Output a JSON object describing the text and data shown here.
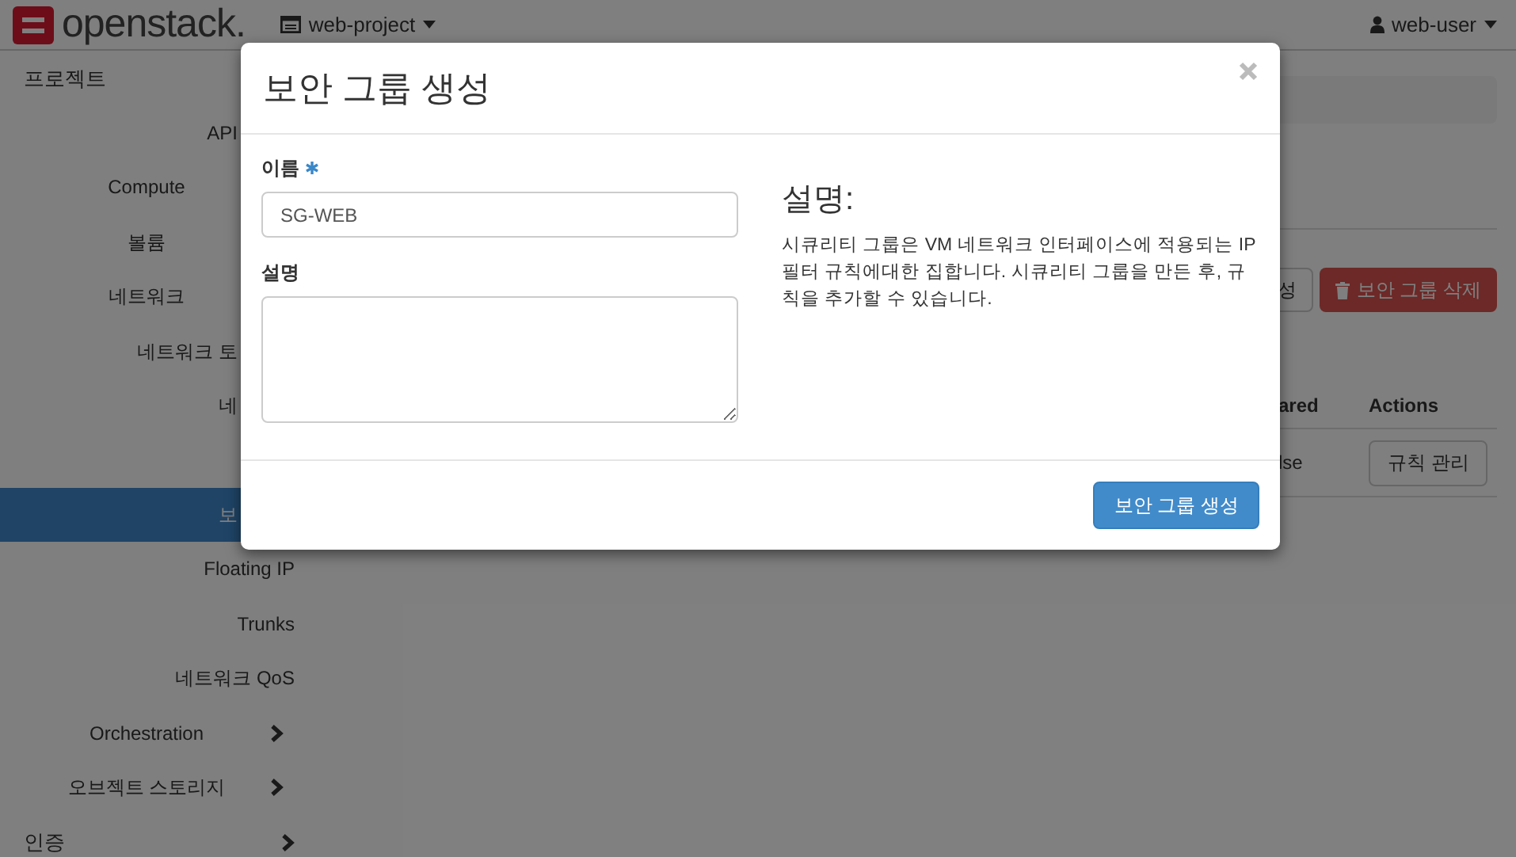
{
  "topbar": {
    "logo": "openstack.",
    "project": "web-project",
    "user": "web-user"
  },
  "sidebar": {
    "items": [
      {
        "kind": "section",
        "label": "프로젝트",
        "selected": false
      },
      {
        "kind": "partial",
        "label": "API",
        "selected": false
      },
      {
        "kind": "group",
        "label": "Compute",
        "selected": false
      },
      {
        "kind": "group",
        "label": "볼륨",
        "selected": false
      },
      {
        "kind": "group",
        "label": "네트워크",
        "selected": false
      },
      {
        "kind": "partial",
        "label": "네트워크 토",
        "selected": false
      },
      {
        "kind": "partial",
        "label": "네",
        "selected": false
      },
      {
        "kind": "partial",
        "label": "보",
        "selected": true
      },
      {
        "kind": "item",
        "label": "Floating IP",
        "selected": false
      },
      {
        "kind": "item",
        "label": "Trunks",
        "selected": false
      },
      {
        "kind": "item",
        "label": "네트워크 QoS",
        "selected": false
      },
      {
        "kind": "group",
        "label": "Orchestration",
        "expanded": false,
        "selected": false
      },
      {
        "kind": "group",
        "label": "오브젝트 스토리지",
        "expanded": false,
        "selected": false
      },
      {
        "kind": "section",
        "label": "인증",
        "expanded": false,
        "selected": false
      }
    ]
  },
  "main": {
    "actions": [
      {
        "kind": "default",
        "label": "성"
      },
      {
        "kind": "danger",
        "label": "보안 그룹 삭제"
      }
    ],
    "table": {
      "columns": [
        "ared",
        "Actions"
      ],
      "rows": [
        {
          "column_1": "lse",
          "action": "규칙 관리"
        }
      ]
    }
  },
  "modal": {
    "title": "보안 그룹 생성",
    "fields": [
      {
        "kind": "input",
        "label": "이름",
        "required": true,
        "value": "SG-WEB"
      },
      {
        "kind": "textarea",
        "label": "설명",
        "required": false
      }
    ],
    "help_title": "설명:",
    "help_text": "시큐리티 그룹은 VM 네트워크 인터페이스에 적용되는 IP 필터 규칙에대한 집합니다. 시큐리티 그룹을 만든 후, 규칙을 추가할 수 있습니다.",
    "submit": "보안 그룹 생성"
  }
}
